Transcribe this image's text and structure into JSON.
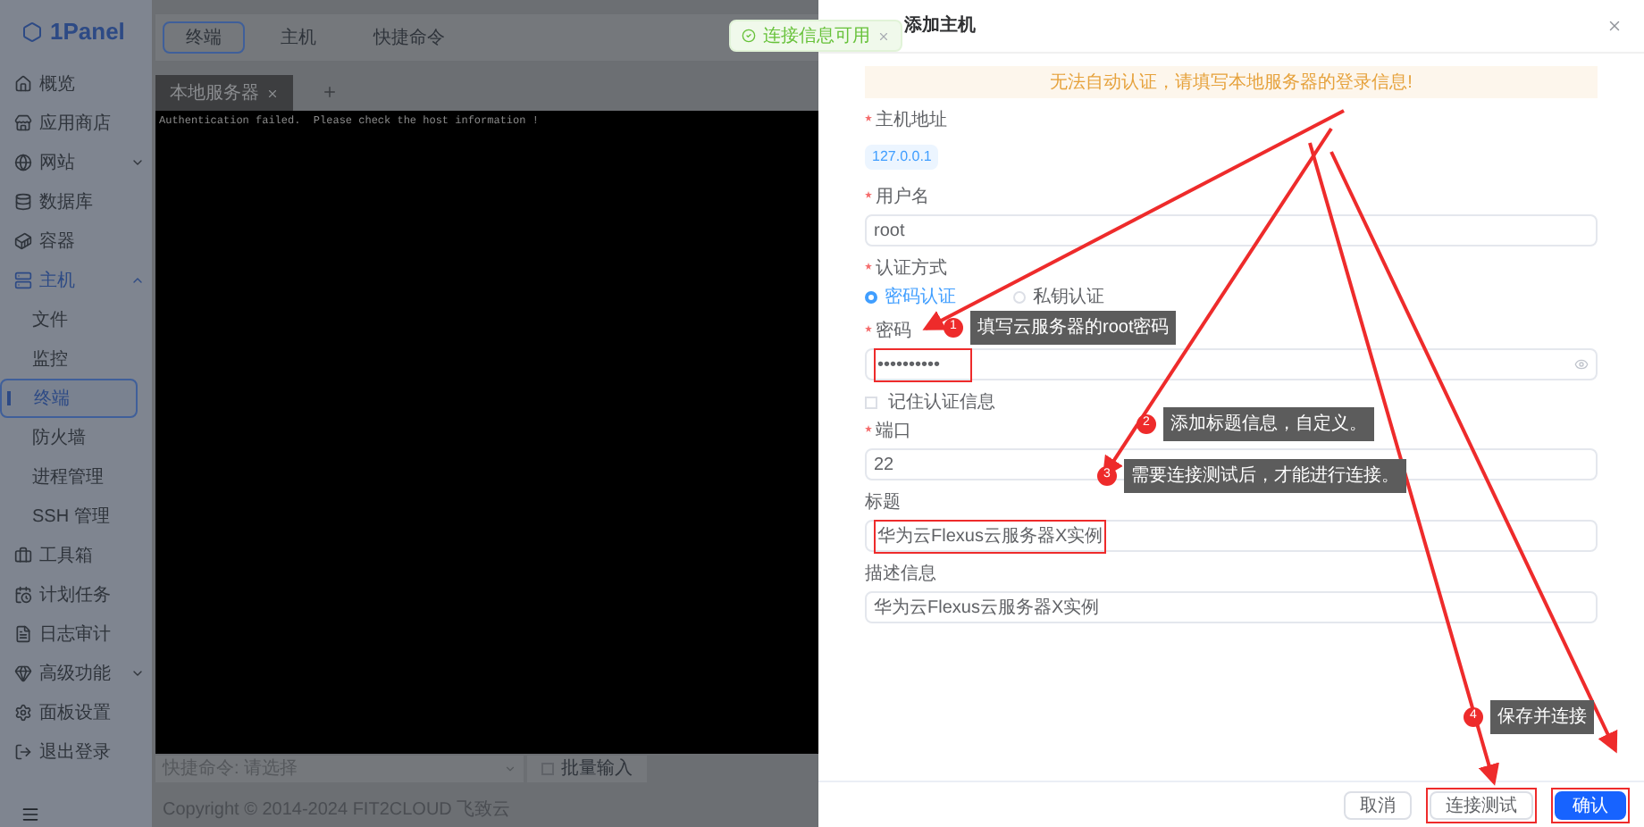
{
  "sidebar": {
    "logo": "1Panel",
    "items": [
      {
        "label": "概览",
        "selected": false
      },
      {
        "label": "应用商店",
        "selected": false
      },
      {
        "label": "网站",
        "selected": false,
        "expanded": false
      },
      {
        "label": "数据库",
        "selected": false
      },
      {
        "label": "容器",
        "selected": false
      },
      {
        "label": "主机",
        "selected": false,
        "expanded": true,
        "children": [
          {
            "label": "文件",
            "selected": false
          },
          {
            "label": "监控",
            "selected": false
          },
          {
            "label": "终端",
            "selected": true
          },
          {
            "label": "防火墙",
            "selected": false
          },
          {
            "label": "进程管理",
            "selected": false
          },
          {
            "label": "SSH 管理",
            "selected": false
          }
        ]
      },
      {
        "label": "工具箱",
        "selected": false
      },
      {
        "label": "计划任务",
        "selected": false
      },
      {
        "label": "日志审计",
        "selected": false
      },
      {
        "label": "高级功能",
        "selected": false,
        "expanded": false
      },
      {
        "label": "面板设置",
        "selected": false
      },
      {
        "label": "退出登录",
        "selected": false
      }
    ]
  },
  "tabs": [
    {
      "label": "终端",
      "selected": true
    },
    {
      "label": "主机",
      "selected": false
    },
    {
      "label": "快捷命令",
      "selected": false
    }
  ],
  "terminal_tabs": [
    {
      "label": "本地服务器",
      "selected": true
    }
  ],
  "terminal_output": "Authentication failed.  Please check the host information !",
  "quick_command": {
    "placeholder": "快捷命令: 请选择"
  },
  "batch_input": {
    "label": "批量输入",
    "checked": false
  },
  "footer": "Copyright © 2014-2024 FIT2CLOUD 飞致云",
  "toast": {
    "text": "连接信息可用"
  },
  "drawer": {
    "title": "添加主机",
    "alert": "无法自动认证，请填写本地服务器的登录信息!",
    "fields": [
      {
        "kind": "tag",
        "label": "主机地址",
        "required": true,
        "value": "127.0.0.1"
      },
      {
        "kind": "input",
        "label": "用户名",
        "required": true,
        "value": "root"
      },
      {
        "kind": "radio",
        "label": "认证方式",
        "required": true,
        "options": [
          {
            "label": "密码认证",
            "selected": true
          },
          {
            "label": "私钥认证",
            "selected": false
          }
        ]
      },
      {
        "kind": "password",
        "label": "密码",
        "required": true,
        "value": "••••••••••",
        "highlighted": true
      },
      {
        "kind": "checkbox",
        "label": "记住认证信息",
        "checked": false
      },
      {
        "kind": "input",
        "label": "端口",
        "required": true,
        "value": "22"
      },
      {
        "kind": "input",
        "label": "标题",
        "required": false,
        "value": "华为云Flexus云服务器X实例",
        "highlighted": true
      },
      {
        "kind": "input",
        "label": "描述信息",
        "required": false,
        "value": "华为云Flexus云服务器X实例",
        "highlighted": false
      }
    ],
    "buttons": [
      {
        "label": "取消",
        "kind": "default",
        "highlighted": false
      },
      {
        "label": "连接测试",
        "kind": "default",
        "highlighted": true
      },
      {
        "label": "确认",
        "kind": "primary",
        "highlighted": true
      }
    ]
  },
  "annotations": [
    {
      "number": "1",
      "text": "填写云服务器的root密码"
    },
    {
      "number": "2",
      "text": "添加标题信息，自定义。"
    },
    {
      "number": "3",
      "text": "需要连接测试后，才能进行连接。"
    },
    {
      "number": "4",
      "text": "保存并连接"
    }
  ]
}
